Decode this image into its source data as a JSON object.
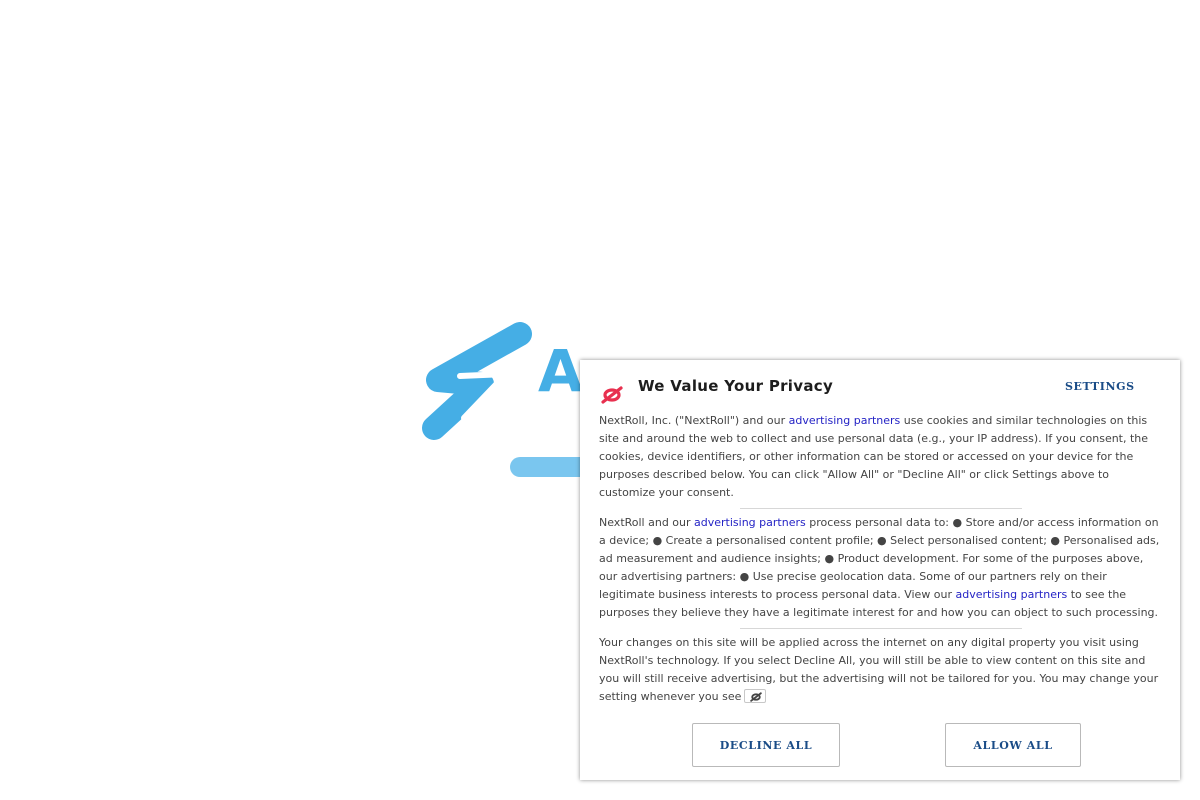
{
  "background": {
    "brand_text": "A",
    "brand_color": "#45aee5"
  },
  "consent": {
    "title": "We Value Your Privacy",
    "settings_label": "SETTINGS",
    "logo_icon": "nextroll-logo-icon",
    "paragraph1": {
      "pre": "NextRoll, Inc. (\"NextRoll\") and our ",
      "link": "advertising partners",
      "post": " use cookies and similar technologies on this site and around the web to collect and use personal data (e.g., your IP address). If you consent, the cookies, device identifiers, or other information can be stored or accessed on your device for the purposes described below. You can click \"Allow All\" or \"Decline All\" or click Settings above to customize your consent."
    },
    "paragraph2": {
      "pre": "NextRoll and our ",
      "link1": "advertising partners",
      "mid": " process personal data to: ● Store and/or access information on a device; ● Create a personalised content profile; ● Select personalised content; ● Personalised ads, ad measurement and audience insights; ● Product development. For some of the purposes above, our advertising partners: ● Use precise geolocation data. Some of our partners rely on their legitimate business interests to process personal data. View our ",
      "link2": "advertising partners",
      "post": " to see the purposes they believe they have a legitimate interest for and how you can object to such processing."
    },
    "paragraph3": {
      "text": "Your changes on this site will be applied across the internet on any digital property you visit using NextRoll's technology. If you select Decline All, you will still be able to view content on this site and you will still receive advertising, but the advertising will not be tailored for you. You may change your setting whenever you see"
    },
    "decline_label": "DECLINE ALL",
    "allow_label": "ALLOW ALL",
    "accent_color": "#1a4c87",
    "link_color": "#2423c5",
    "logo_color": "#e8304f"
  }
}
